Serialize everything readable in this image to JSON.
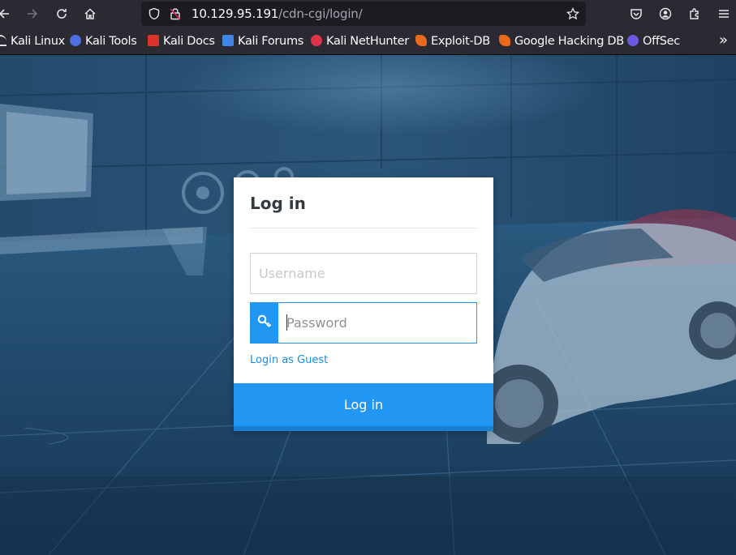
{
  "browser": {
    "url_host": "10.129.95.191",
    "url_path": "/cdn-cgi/login/",
    "bookmarks": [
      {
        "label": "Kali Linux",
        "icon": "kali-dragon-icon",
        "color": "#ffffff"
      },
      {
        "label": "Kali Tools",
        "icon": "kali-tools-icon",
        "color": "#4d6fe0"
      },
      {
        "label": "Kali Docs",
        "icon": "kali-docs-icon",
        "color": "#d9332b"
      },
      {
        "label": "Kali Forums",
        "icon": "kali-forums-icon",
        "color": "#3f86e6"
      },
      {
        "label": "Kali NetHunter",
        "icon": "nethunter-icon",
        "color": "#e0334a"
      },
      {
        "label": "Exploit-DB",
        "icon": "exploit-db-icon",
        "color": "#e86a1c"
      },
      {
        "label": "Google Hacking DB",
        "icon": "ghdb-icon",
        "color": "#e86a1c"
      },
      {
        "label": "OffSec",
        "icon": "offsec-icon",
        "color": "#6a5ae0"
      }
    ]
  },
  "login": {
    "title": "Log in",
    "username_placeholder": "Username",
    "password_placeholder": "Password",
    "guest_link": "Login as Guest",
    "button_label": "Log in",
    "accent_color": "#2196f3"
  }
}
